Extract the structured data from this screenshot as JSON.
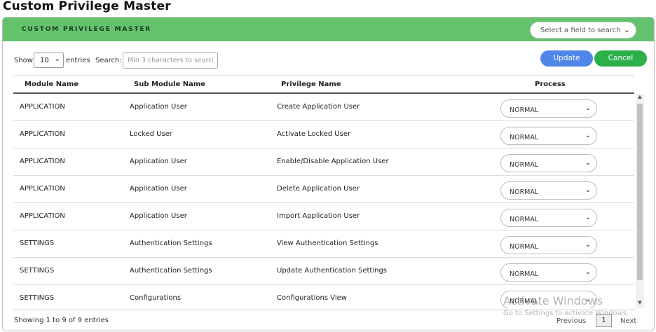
{
  "page": {
    "title": "Custom Privilege Master"
  },
  "panel": {
    "header_title": "CUSTOM PRIVILEGE MASTER",
    "field_search_placeholder": "Select a field to search"
  },
  "controls": {
    "show_label": "Show",
    "entries_value": "10",
    "entries_label": "entries",
    "search_label": "Search:",
    "search_placeholder": "Min 3 characters to search",
    "update_label": "Update",
    "cancel_label": "Cancel"
  },
  "table": {
    "columns": [
      "Module Name",
      "Sub Module Name",
      "Privilege Name",
      "Process"
    ],
    "rows": [
      {
        "module": "APPLICATION",
        "sub_module": "Application User",
        "privilege": "Create Application User",
        "process": "NORMAL"
      },
      {
        "module": "APPLICATION",
        "sub_module": "Locked User",
        "privilege": "Activate Locked User",
        "process": "NORMAL"
      },
      {
        "module": "APPLICATION",
        "sub_module": "Application User",
        "privilege": "Enable/Disable Application User",
        "process": "NORMAL"
      },
      {
        "module": "APPLICATION",
        "sub_module": "Application User",
        "privilege": "Delete Application User",
        "process": "NORMAL"
      },
      {
        "module": "APPLICATION",
        "sub_module": "Application User",
        "privilege": "Import Application User",
        "process": "NORMAL"
      },
      {
        "module": "SETTINGS",
        "sub_module": "Authentication Settings",
        "privilege": "View Authentication Settings",
        "process": "NORMAL"
      },
      {
        "module": "SETTINGS",
        "sub_module": "Authentication Settings",
        "privilege": "Update Authentication Settings",
        "process": "NORMAL"
      },
      {
        "module": "SETTINGS",
        "sub_module": "Configurations",
        "privilege": "Configurations View",
        "process": "NORMAL"
      }
    ]
  },
  "footer": {
    "info": "Showing 1 to 9 of 9 entries",
    "previous": "Previous",
    "current_page": "1",
    "next": "Next"
  },
  "watermark": {
    "title": "Activate Windows",
    "subtitle": "Go to Settings to activate Windows."
  },
  "colors": {
    "header_green": "#64c26d",
    "update_blue": "#4f86e8",
    "cancel_green": "#2bb04a"
  }
}
